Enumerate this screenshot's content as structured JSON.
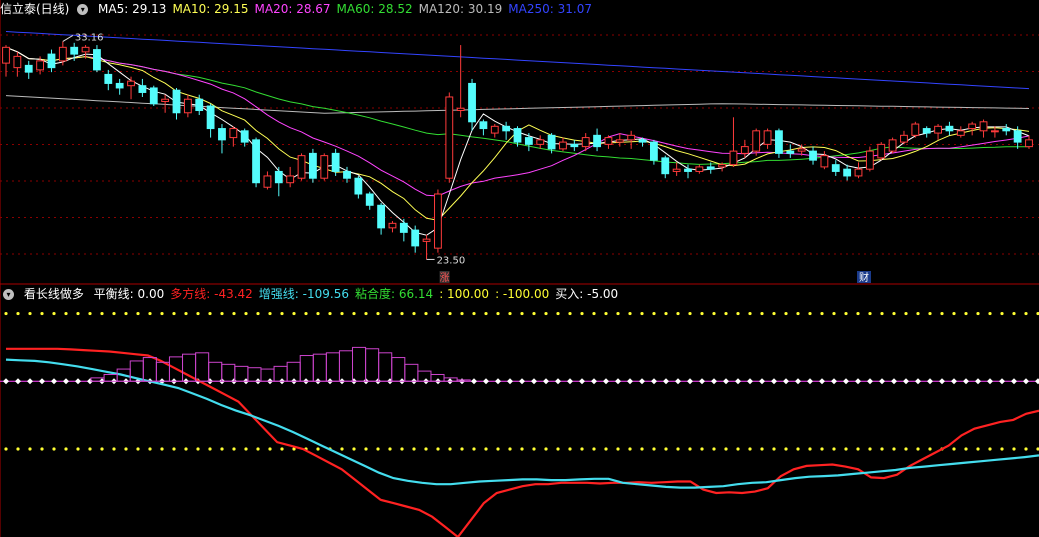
{
  "colors": {
    "up": "#ff3b3b",
    "down": "#54fcfc",
    "ma5": "#ffffff",
    "ma10": "#ffff55",
    "ma20": "#ff44ff",
    "ma60": "#33dd33",
    "ma120": "#bbbbbb",
    "ma250": "#3344ff",
    "grid": "#8b0000",
    "border": "#aa0000",
    "duo": "#ff2222",
    "zeng": "#44ddee",
    "dots": "#ffff33",
    "balance": "#ff44ff",
    "hist": "#cc44cc"
  },
  "header": {
    "icon": "chevron-down-icon",
    "name": "信立泰(日线)",
    "ma": [
      {
        "label": "MA5: 29.13",
        "key": "ma5"
      },
      {
        "label": "MA10: 29.15",
        "key": "ma10"
      },
      {
        "label": "MA20: 28.67",
        "key": "ma20"
      },
      {
        "label": "MA60: 28.52",
        "key": "ma60"
      },
      {
        "label": "MA120: 30.19",
        "key": "ma120"
      },
      {
        "label": "MA250: 31.07",
        "key": "ma250"
      }
    ]
  },
  "indicator_header": {
    "icon": "chevron-down-icon",
    "name": "看长线做多",
    "items": [
      {
        "label": "平衡线: 0.00",
        "key": "text"
      },
      {
        "label": "多方线: -43.42",
        "key": "duo"
      },
      {
        "label": "增强线: -109.56",
        "key": "zeng"
      },
      {
        "label": "粘合度: 66.14",
        "key": "ma60"
      },
      {
        "label": ": 100.00",
        "key": "dots"
      },
      {
        "label": ": -100.00",
        "key": "dots"
      },
      {
        "label": "买入: -5.00",
        "key": "text"
      }
    ]
  },
  "annotations": {
    "high": "33.16",
    "low": "23.50",
    "mark_zhang": "涨",
    "mark_cai": "财"
  },
  "chart_data": [
    {
      "type": "candlestick",
      "title": "信立泰(日线)",
      "ylim": [
        22.5,
        34.2
      ],
      "candles": [
        [
          32.2,
          32.9,
          31.6,
          33.0
        ],
        [
          32.0,
          32.5,
          31.6,
          32.7
        ],
        [
          32.1,
          31.8,
          31.5,
          32.3
        ],
        [
          31.9,
          32.3,
          31.7,
          32.5
        ],
        [
          32.6,
          32.0,
          31.8,
          32.8
        ],
        [
          32.3,
          32.9,
          32.1,
          33.16
        ],
        [
          32.9,
          32.6,
          32.3,
          33.1
        ],
        [
          32.7,
          32.9,
          32.4,
          33.0
        ],
        [
          32.8,
          31.9,
          31.8,
          33.0
        ],
        [
          31.7,
          31.3,
          31.0,
          31.9
        ],
        [
          31.3,
          31.1,
          30.8,
          31.5
        ],
        [
          31.2,
          31.4,
          30.6,
          31.6
        ],
        [
          31.2,
          30.9,
          30.7,
          31.5
        ],
        [
          31.1,
          30.4,
          30.3,
          31.2
        ],
        [
          30.5,
          30.6,
          30.0,
          30.8
        ],
        [
          31.0,
          30.0,
          29.7,
          31.1
        ],
        [
          30.0,
          30.6,
          29.8,
          30.8
        ],
        [
          30.6,
          30.1,
          29.9,
          30.8
        ],
        [
          30.3,
          29.3,
          28.9,
          30.4
        ],
        [
          29.3,
          28.8,
          28.2,
          29.5
        ],
        [
          28.9,
          29.3,
          28.5,
          29.4
        ],
        [
          29.2,
          28.7,
          28.5,
          29.3
        ],
        [
          28.8,
          26.9,
          26.7,
          28.9
        ],
        [
          26.7,
          27.2,
          26.6,
          27.4
        ],
        [
          27.4,
          26.9,
          26.3,
          27.6
        ],
        [
          26.9,
          27.2,
          26.7,
          27.6
        ],
        [
          27.1,
          28.1,
          27.0,
          28.2
        ],
        [
          28.2,
          27.1,
          26.9,
          28.4
        ],
        [
          27.1,
          28.1,
          27.0,
          28.2
        ],
        [
          28.2,
          27.4,
          27.2,
          28.4
        ],
        [
          27.4,
          27.1,
          26.9,
          27.6
        ],
        [
          27.1,
          26.4,
          26.2,
          27.2
        ],
        [
          26.4,
          25.9,
          25.7,
          26.5
        ],
        [
          25.9,
          24.9,
          24.6,
          26.0
        ],
        [
          24.9,
          25.1,
          24.7,
          25.2
        ],
        [
          25.1,
          24.7,
          24.3,
          25.3
        ],
        [
          24.8,
          24.1,
          23.8,
          25.0
        ],
        [
          24.3,
          24.4,
          23.5,
          24.6
        ],
        [
          24.0,
          26.4,
          23.8,
          26.6
        ],
        [
          27.1,
          30.7,
          26.9,
          30.9
        ],
        [
          30.1,
          30.2,
          29.8,
          33.0
        ],
        [
          31.3,
          29.6,
          29.2,
          31.5
        ],
        [
          29.6,
          29.3,
          29.0,
          29.7
        ],
        [
          29.1,
          29.4,
          28.9,
          29.5
        ],
        [
          29.4,
          29.2,
          28.8,
          29.6
        ],
        [
          29.3,
          28.7,
          28.5,
          29.4
        ],
        [
          28.9,
          28.6,
          28.3,
          29.1
        ],
        [
          28.6,
          28.8,
          28.4,
          29.0
        ],
        [
          29.0,
          28.4,
          28.2,
          29.1
        ],
        [
          28.4,
          28.7,
          28.3,
          28.9
        ],
        [
          28.6,
          28.5,
          28.3,
          28.8
        ],
        [
          28.5,
          28.9,
          28.3,
          29.1
        ],
        [
          29.0,
          28.5,
          28.3,
          29.3
        ],
        [
          28.6,
          28.9,
          28.4,
          29.0
        ],
        [
          28.7,
          28.8,
          28.5,
          29.1
        ],
        [
          28.8,
          29.0,
          28.4,
          29.2
        ],
        [
          28.8,
          28.7,
          28.5,
          28.9
        ],
        [
          28.7,
          27.9,
          27.7,
          28.8
        ],
        [
          28.0,
          27.3,
          27.1,
          28.1
        ],
        [
          27.4,
          27.5,
          27.2,
          27.8
        ],
        [
          27.5,
          27.4,
          27.1,
          27.7
        ],
        [
          27.4,
          27.6,
          27.3,
          27.7
        ],
        [
          27.6,
          27.5,
          27.3,
          27.8
        ],
        [
          27.6,
          27.7,
          27.4,
          27.8
        ],
        [
          27.7,
          28.3,
          27.6,
          29.8
        ],
        [
          28.2,
          28.5,
          28.0,
          28.8
        ],
        [
          28.3,
          29.2,
          28.1,
          29.3
        ],
        [
          28.6,
          29.2,
          28.4,
          29.3
        ],
        [
          29.2,
          28.2,
          28.0,
          29.3
        ],
        [
          28.3,
          28.2,
          28.0,
          28.6
        ],
        [
          28.3,
          28.4,
          28.1,
          28.6
        ],
        [
          28.3,
          27.9,
          27.7,
          28.5
        ],
        [
          27.6,
          28.1,
          27.5,
          28.3
        ],
        [
          27.7,
          27.4,
          27.2,
          27.9
        ],
        [
          27.5,
          27.2,
          27.0,
          27.7
        ],
        [
          27.2,
          27.5,
          27.1,
          27.8
        ],
        [
          27.5,
          28.3,
          27.4,
          28.5
        ],
        [
          28.0,
          28.6,
          27.9,
          28.7
        ],
        [
          28.3,
          28.8,
          28.2,
          28.9
        ],
        [
          28.7,
          29.0,
          28.6,
          29.2
        ],
        [
          29.0,
          29.5,
          28.9,
          29.6
        ],
        [
          29.3,
          29.1,
          28.9,
          29.4
        ],
        [
          29.1,
          29.4,
          28.8,
          29.5
        ],
        [
          29.4,
          29.2,
          29.0,
          29.6
        ],
        [
          29.0,
          29.2,
          28.9,
          29.4
        ],
        [
          29.3,
          29.5,
          29.0,
          29.6
        ],
        [
          29.2,
          29.6,
          28.9,
          29.7
        ],
        [
          29.2,
          29.2,
          28.9,
          29.4
        ],
        [
          29.3,
          29.2,
          29.0,
          29.5
        ],
        [
          29.2,
          28.7,
          28.4,
          29.4
        ],
        [
          28.5,
          28.8,
          28.4,
          29.0
        ]
      ]
    },
    {
      "type": "line",
      "title": "看长线做多",
      "ylim": [
        -230,
        120
      ],
      "levels": {
        "upper": 100,
        "balance": 0,
        "lower": -100
      },
      "series": [
        {
          "name": "多方线",
          "key": "duo",
          "values": [
            48,
            48,
            48,
            48,
            48,
            47,
            46,
            45,
            44,
            42,
            40,
            38,
            30,
            20,
            10,
            0,
            -10,
            -20,
            -30,
            -50,
            -70,
            -90,
            -95,
            -100,
            -110,
            -120,
            -130,
            -145,
            -160,
            -175,
            -180,
            -185,
            -190,
            -200,
            -215,
            -230,
            -205,
            -180,
            -165,
            -160,
            -155,
            -152,
            -152,
            -150,
            -150,
            -150,
            -151,
            -150,
            -150,
            -149,
            -150,
            -149,
            -148,
            -148,
            -160,
            -165,
            -164,
            -165,
            -163,
            -158,
            -140,
            -130,
            -125,
            -124,
            -123,
            -126,
            -130,
            -142,
            -143,
            -138,
            -125,
            -115,
            -105,
            -95,
            -80,
            -70,
            -65,
            -60,
            -57,
            -48,
            -43.42
          ]
        },
        {
          "name": "增强线",
          "key": "zeng",
          "values": [
            32,
            31,
            30,
            28,
            25,
            22,
            18,
            14,
            10,
            5,
            0,
            -5,
            -10,
            -18,
            -26,
            -35,
            -43,
            -50,
            -58,
            -66,
            -75,
            -85,
            -95,
            -105,
            -115,
            -125,
            -135,
            -143,
            -147,
            -150,
            -152,
            -152,
            -150,
            -148,
            -147,
            -146,
            -145,
            -145,
            -146,
            -146,
            -145,
            -144,
            -144,
            -150,
            -152,
            -154,
            -156,
            -157,
            -157,
            -156,
            -155,
            -152,
            -150,
            -149,
            -146,
            -143,
            -141,
            -140,
            -139,
            -137,
            -135,
            -133,
            -131,
            -128,
            -126,
            -124,
            -122,
            -120,
            -118,
            -116,
            -114,
            -112,
            -109.56
          ]
        },
        {
          "name": "粘合度",
          "key": "hist",
          "values": [
            0,
            0,
            0,
            0,
            0,
            0,
            0,
            5,
            10,
            18,
            30,
            35,
            28,
            36,
            40,
            42,
            28,
            25,
            22,
            20,
            18,
            22,
            28,
            38,
            40,
            42,
            45,
            50,
            48,
            42,
            35,
            25,
            15,
            10,
            5,
            2,
            0,
            0,
            0,
            0,
            0,
            0,
            0,
            0,
            0,
            0,
            0,
            0,
            0,
            0,
            0,
            0,
            0,
            0,
            0,
            0,
            0,
            0,
            0,
            0,
            0,
            0,
            0,
            0,
            0,
            0,
            0,
            0,
            0,
            0,
            0,
            0,
            0,
            0,
            0,
            0,
            0,
            0,
            0,
            0
          ]
        }
      ]
    }
  ]
}
